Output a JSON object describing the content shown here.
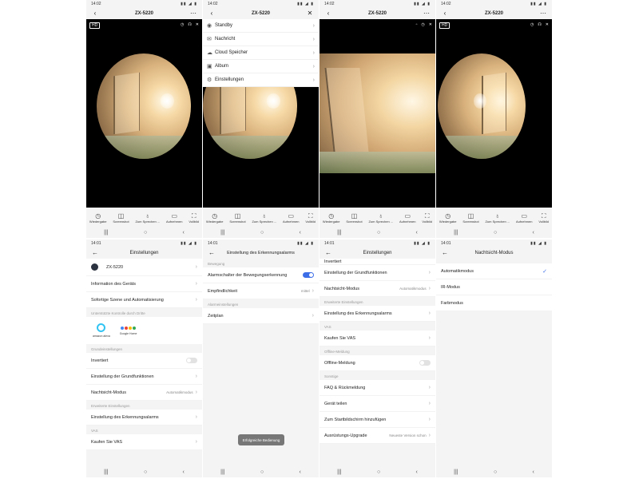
{
  "status": {
    "time_top": "14:02",
    "time_bottom": "14:01",
    "icons": "▮▮ ◢ ▮"
  },
  "live": {
    "title": "ZX-5220",
    "hd_badge": "HD",
    "controls": [
      {
        "label": "Wiedergabe",
        "glyph": "◷"
      },
      {
        "label": "Screenshot",
        "glyph": "◫"
      },
      {
        "label": "Zum Sprechen ...",
        "glyph": "♁"
      },
      {
        "label": "Aufnehmen",
        "glyph": "▭"
      },
      {
        "label": "Vollbild",
        "glyph": "⛶"
      }
    ]
  },
  "menu": {
    "items": [
      {
        "label": "Standby",
        "glyph": "◉"
      },
      {
        "label": "Nachricht",
        "glyph": "✉"
      },
      {
        "label": "Cloud Speicher",
        "glyph": "☁"
      },
      {
        "label": "Album",
        "glyph": "▣"
      },
      {
        "label": "Einstellungen",
        "glyph": "⚙"
      }
    ]
  },
  "settings": {
    "title": "Einstellungen",
    "device_name": "ZX-5220",
    "info": "Information des Geräts",
    "scene": "Sofortige Szene und Automatisierung",
    "third_party": "Unterstützte Kontrolle durch Dritte",
    "alexa": "amazon alexa",
    "google": "Google Home",
    "basic_section": "Grundeinstellungen",
    "inverted": "Invertiert",
    "basic_functions": "Einstellung der Grundfunktionen",
    "night_mode": "Nachtsicht-Modus",
    "night_mode_value": "Automatikmodus",
    "advanced_section": "Erweiterte Einstellungen",
    "detection_alarm": "Einstellung des Erkennungsalarms",
    "vas_section": "VAS",
    "buy_vas": "Kaufen Sie VAS"
  },
  "detection": {
    "title": "Einstellung des Erkennungsalarms",
    "motion_section": "Bewegung",
    "motion_switch": "Alarmschalter der Bewegungserkennung",
    "sensitivity": "Empfindlichkeit",
    "sensitivity_value": "mittel",
    "alarm_section": "Alarmeinstellungen",
    "schedule": "Zeitplan",
    "toast": "Erfolgreiche Bedienung"
  },
  "settings2": {
    "title": "Einstellungen",
    "inverted": "Invertiert",
    "basic_functions": "Einstellung der Grundfunktionen",
    "night_mode": "Nachtsicht-Modus",
    "night_mode_value": "Automatikmodus",
    "advanced_section": "Erweiterte Einstellungen",
    "detection_alarm": "Einstellung des Erkennungsalarms",
    "vas_section": "VAS",
    "buy_vas": "Kaufen Sie VAS",
    "offline_section": "Offline-Meldung",
    "offline_notice": "Offline-Meldung",
    "other_section": "Sonstige",
    "faq": "FAQ & Rückmeldung",
    "share": "Gerät teilen",
    "homescreen": "Zum Startbildschirm hinzufügen",
    "upgrade": "Ausrüstungs-Upgrade",
    "upgrade_value": "Neueste Version schon"
  },
  "nightvision": {
    "title": "Nachtsicht-Modus",
    "options": [
      "Automatikmodus",
      "IR-Modus",
      "Farbmodus"
    ]
  }
}
